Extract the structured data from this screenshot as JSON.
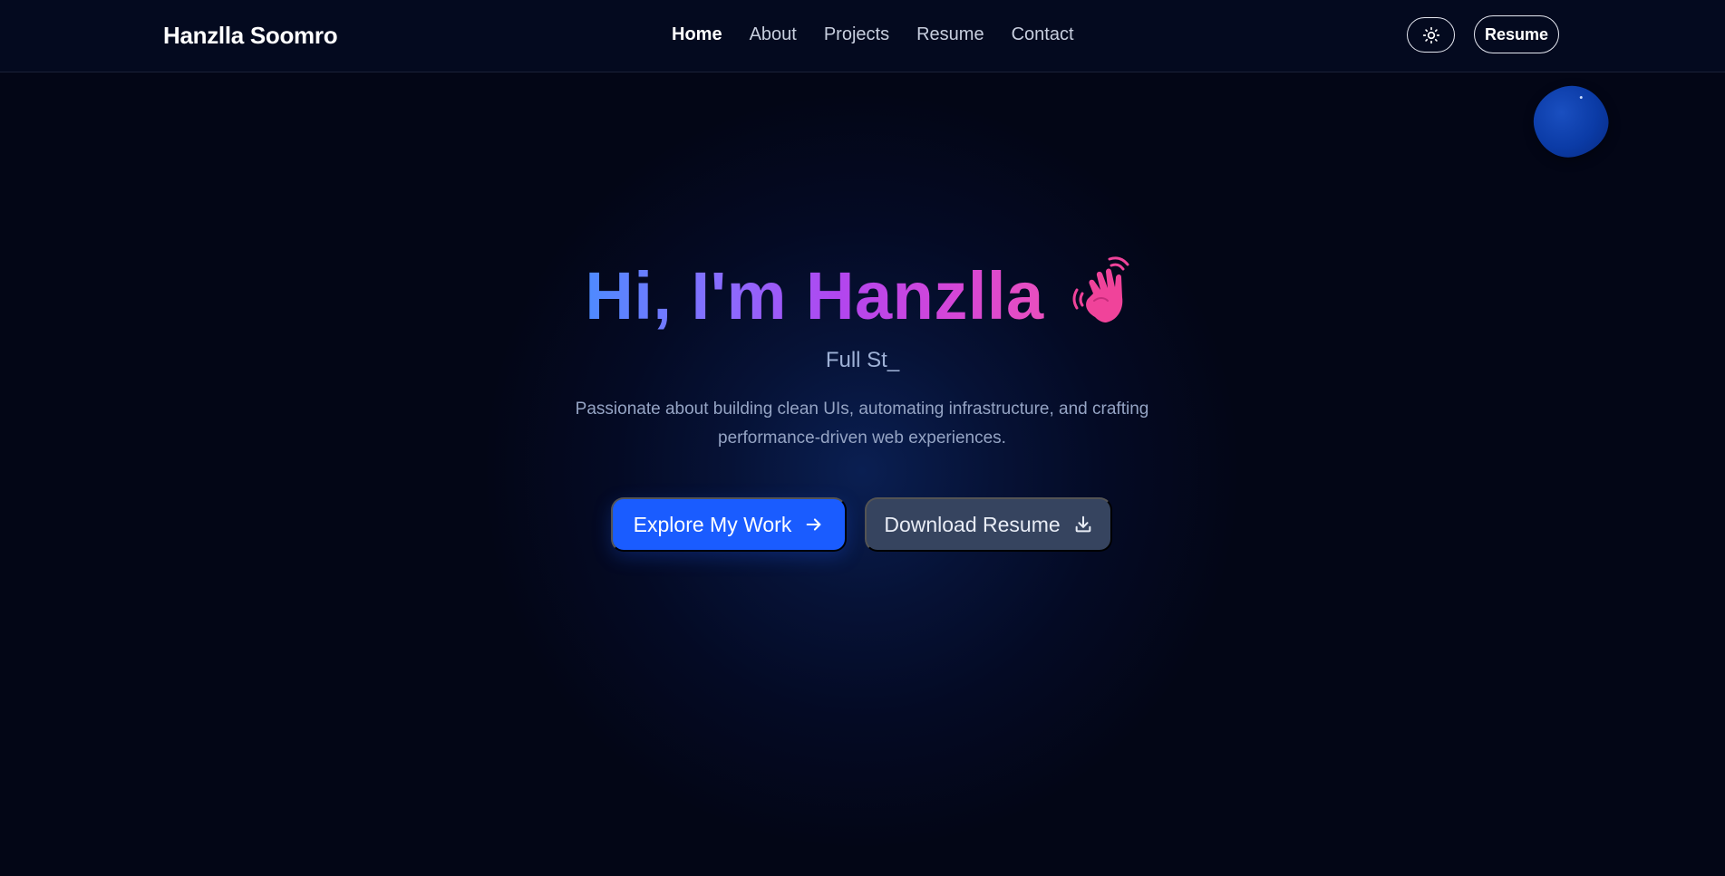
{
  "nav": {
    "brand": "Hanzlla Soomro",
    "links": [
      {
        "label": "Home",
        "active": true
      },
      {
        "label": "About",
        "active": false
      },
      {
        "label": "Projects",
        "active": false
      },
      {
        "label": "Resume",
        "active": false
      },
      {
        "label": "Contact",
        "active": false
      }
    ],
    "theme_toggle_icon": "sun-icon",
    "resume_button": "Resume"
  },
  "hero": {
    "title": "Hi, I'm Hanzlla",
    "title_icon": "waving-hand-icon",
    "subtitle": "Full St_",
    "description": "Passionate about building clean UIs, automating infrastructure, and crafting performance-driven web experiences.",
    "primary_button": {
      "label": "Explore My Work",
      "icon": "arrow-right-icon"
    },
    "secondary_button": {
      "label": "Download Resume",
      "icon": "download-icon"
    }
  },
  "colors": {
    "background": "#030616",
    "primary_button": "#1a5cff",
    "secondary_button": "#36445f",
    "title_gradient_start": "#4d8bff",
    "title_gradient_end": "#e94fbe",
    "wave_emoji": "#f0439a"
  }
}
